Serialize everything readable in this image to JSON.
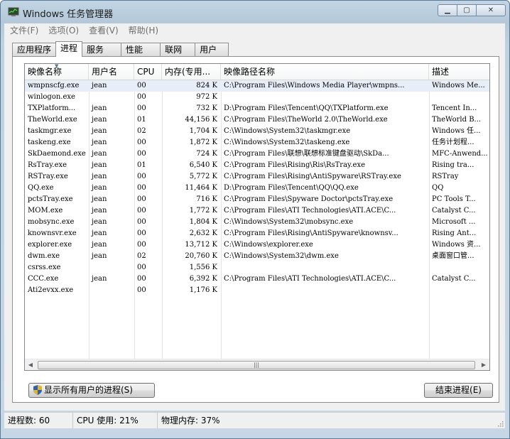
{
  "window": {
    "title": "Windows 任务管理器"
  },
  "menu": [
    "文件(F)",
    "选项(O)",
    "查看(V)",
    "帮助(H)"
  ],
  "tabs": [
    "应用程序",
    "进程",
    "服务",
    "性能",
    "联网",
    "用户"
  ],
  "active_tab": 1,
  "columns": [
    "映像名称",
    "用户名",
    "CPU",
    "内存(专用...",
    "映像路径名称",
    "描述"
  ],
  "processes": [
    {
      "name": "wmpnscfg.exe",
      "user": "jean",
      "cpu": "00",
      "mem": "824 K",
      "path": "C:\\Program Files\\Windows Media Player\\wmpns...",
      "desc": "Windows Me..."
    },
    {
      "name": "winlogon.exe",
      "user": "",
      "cpu": "00",
      "mem": "972 K",
      "path": "",
      "desc": ""
    },
    {
      "name": "TXPlatform...",
      "user": "jean",
      "cpu": "00",
      "mem": "732 K",
      "path": "D:\\Program Files\\Tencent\\QQ\\TXPlatform.exe",
      "desc": "Tencent In..."
    },
    {
      "name": "TheWorld.exe",
      "user": "jean",
      "cpu": "01",
      "mem": "44,156 K",
      "path": "C:\\Program Files\\TheWorld 2.0\\TheWorld.exe",
      "desc": "TheWorld B..."
    },
    {
      "name": "taskmgr.exe",
      "user": "jean",
      "cpu": "02",
      "mem": "1,704 K",
      "path": "C:\\Windows\\System32\\taskmgr.exe",
      "desc": "Windows 任..."
    },
    {
      "name": "taskeng.exe",
      "user": "jean",
      "cpu": "00",
      "mem": "1,872 K",
      "path": "C:\\Windows\\System32\\taskeng.exe",
      "desc": "任务计划程..."
    },
    {
      "name": "SkDaemond.exe",
      "user": "jean",
      "cpu": "00",
      "mem": "724 K",
      "path": "C:\\Program Files\\联想\\联想标准键盘驱动\\SkDa...",
      "desc": "MFC-Anwend..."
    },
    {
      "name": "RsTray.exe",
      "user": "jean",
      "cpu": "01",
      "mem": "6,540 K",
      "path": "C:\\Program Files\\Rising\\Ris\\RsTray.exe",
      "desc": "Rising tra..."
    },
    {
      "name": "RSTray.exe",
      "user": "jean",
      "cpu": "00",
      "mem": "5,772 K",
      "path": "C:\\Program Files\\Rising\\AntiSpyware\\RSTray.exe",
      "desc": "RSTray"
    },
    {
      "name": "QQ.exe",
      "user": "jean",
      "cpu": "00",
      "mem": "11,464 K",
      "path": "D:\\Program Files\\Tencent\\QQ\\QQ.exe",
      "desc": "QQ"
    },
    {
      "name": "pctsTray.exe",
      "user": "jean",
      "cpu": "00",
      "mem": "716 K",
      "path": "C:\\Program Files\\Spyware Doctor\\pctsTray.exe",
      "desc": "PC Tools T..."
    },
    {
      "name": "MOM.exe",
      "user": "jean",
      "cpu": "00",
      "mem": "1,772 K",
      "path": "C:\\Program Files\\ATI Technologies\\ATI.ACE\\C...",
      "desc": "Catalyst C..."
    },
    {
      "name": "mobsync.exe",
      "user": "jean",
      "cpu": "00",
      "mem": "1,804 K",
      "path": "C:\\Windows\\System32\\mobsync.exe",
      "desc": "Microsoft ..."
    },
    {
      "name": "knownsvr.exe",
      "user": "jean",
      "cpu": "00",
      "mem": "2,632 K",
      "path": "C:\\Program Files\\Rising\\AntiSpyware\\knownsv...",
      "desc": "Rising Ant..."
    },
    {
      "name": "explorer.exe",
      "user": "jean",
      "cpu": "00",
      "mem": "13,712 K",
      "path": "C:\\Windows\\explorer.exe",
      "desc": "Windows 资..."
    },
    {
      "name": "dwm.exe",
      "user": "jean",
      "cpu": "02",
      "mem": "20,760 K",
      "path": "C:\\Windows\\System32\\dwm.exe",
      "desc": "桌面窗口管..."
    },
    {
      "name": "csrss.exe",
      "user": "",
      "cpu": "00",
      "mem": "1,556 K",
      "path": "",
      "desc": ""
    },
    {
      "name": "CCC.exe",
      "user": "jean",
      "cpu": "00",
      "mem": "6,392 K",
      "path": "C:\\Program Files\\ATI Technologies\\ATI.ACE\\C...",
      "desc": "Catalyst C..."
    },
    {
      "name": "Ati2evxx.exe",
      "user": "",
      "cpu": "00",
      "mem": "1,176 K",
      "path": "",
      "desc": ""
    }
  ],
  "buttons": {
    "show_all": "显示所有用户的进程(S)",
    "end_process": "结束进程(E)"
  },
  "status": {
    "processes": "进程数: 60",
    "cpu": "CPU 使用: 21%",
    "memory": "物理内存: 37%"
  },
  "icons": [
    "task-manager-icon",
    "minimize-icon",
    "maximize-icon",
    "close-icon",
    "uac-shield-icon",
    "sort-arrow-icon",
    "scroll-left-icon",
    "scroll-right-icon",
    "size-grip-icon"
  ]
}
